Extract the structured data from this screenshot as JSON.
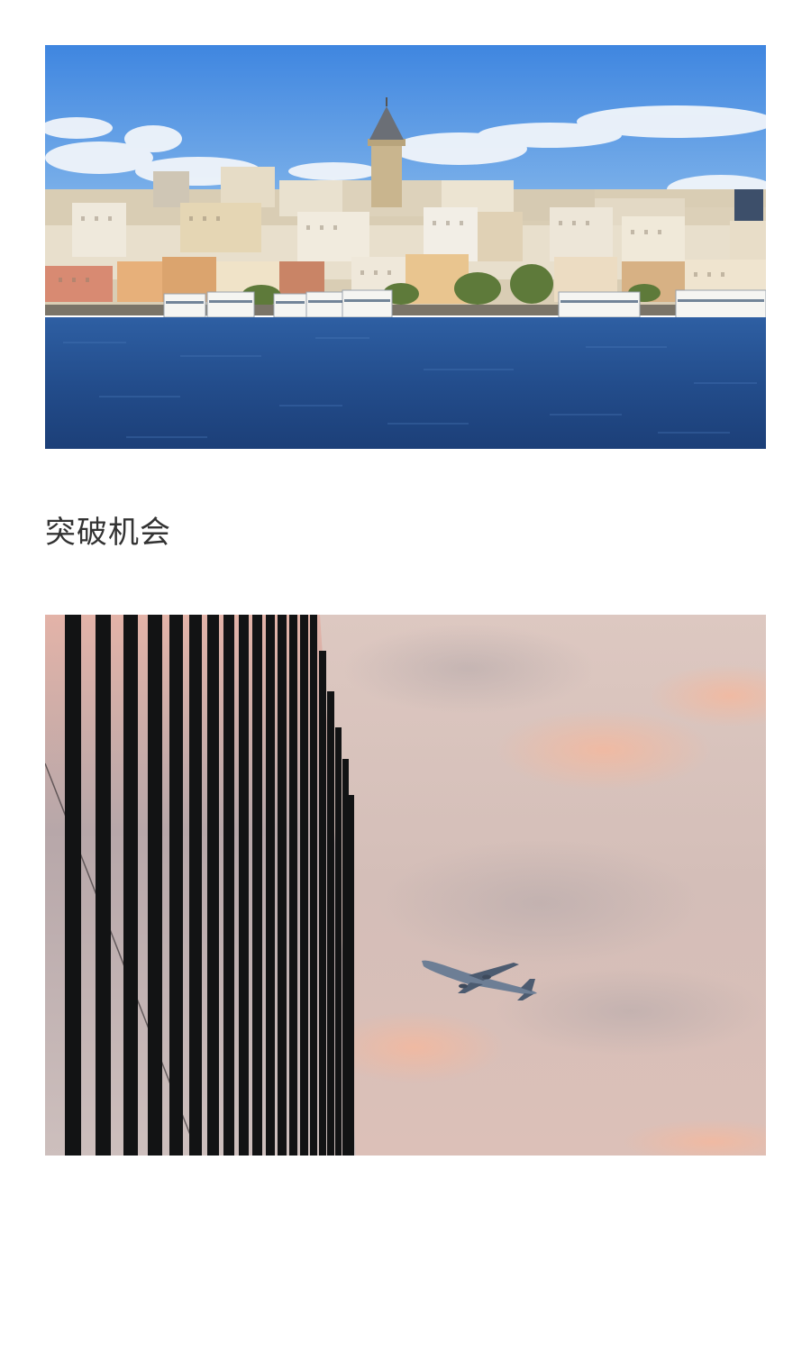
{
  "article": {
    "section_heading": "突破机会"
  },
  "images": {
    "city": {
      "subject": "galata-waterfront-photo"
    },
    "plane": {
      "subject": "airplane-skyscraper-photo"
    }
  },
  "colors": {
    "background": "#ffffff",
    "heading_text": "#333333",
    "sky_blue": "#4d8ee0",
    "water_blue": "#24508f",
    "dusk_pink": "#d9b8b2"
  }
}
